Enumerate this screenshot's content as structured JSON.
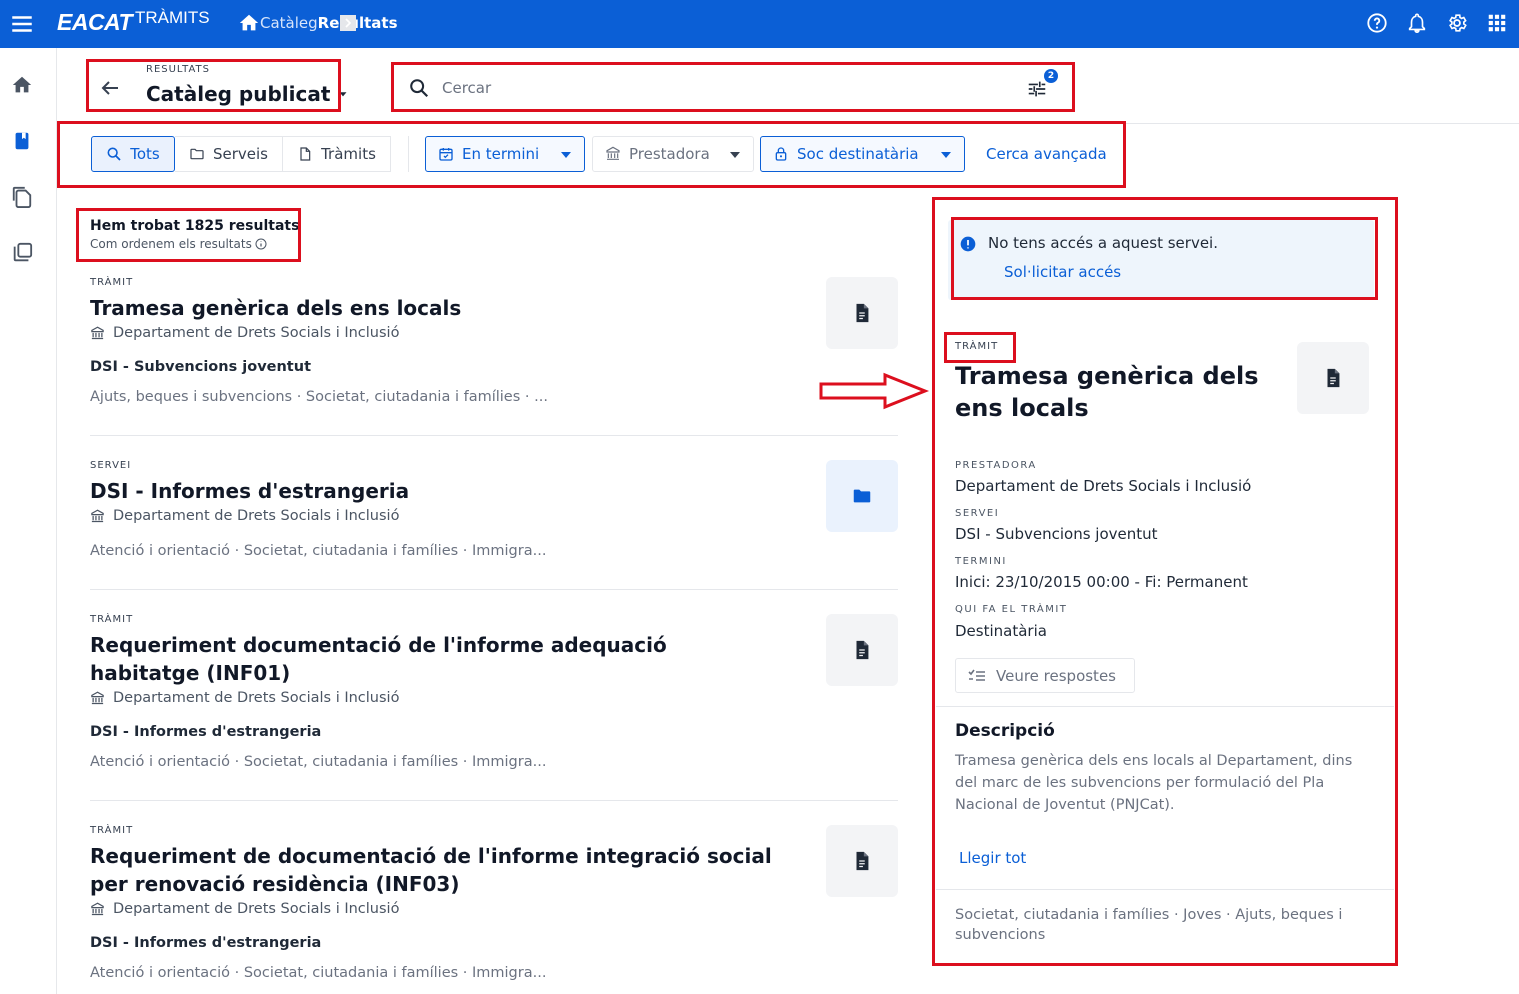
{
  "topbar": {
    "logo_main": "EACAT",
    "logo_sub": "TRÀMITS",
    "breadcrumb": [
      "Catàleg",
      "Resultats"
    ],
    "icons": [
      "help-icon",
      "bell-icon",
      "gear-icon",
      "apps-grid-icon"
    ]
  },
  "sidebar": {
    "items": [
      "home-icon",
      "catalog-book-icon",
      "documents-icon",
      "copies-icon"
    ]
  },
  "header": {
    "small_label": "RESULTATS",
    "title": "Catàleg publicat",
    "search_placeholder": "Cercar",
    "filter_count": "2"
  },
  "filters": {
    "segments": [
      "Tots",
      "Serveis",
      "Tràmits"
    ],
    "in_term": "En termini",
    "provider": "Prestadora",
    "recipient": "Soc destinatària",
    "advanced": "Cerca avançada"
  },
  "results": {
    "count": "Hem trobat 1825 resultats",
    "sort_note": "Com ordenem els resultats",
    "items": [
      {
        "kind": "TRÀMIT",
        "title": "Tramesa genèrica dels ens locals",
        "dept": "Departament de Drets Socials i Inclusió",
        "service": "DSI - Subvencions joventut",
        "tags": "Ajuts, beques i subvencions · Societat, ciutadania i famílies · ..."
      },
      {
        "kind": "SERVEI",
        "title": "DSI - Informes d'estrangeria",
        "dept": "Departament de Drets Socials i Inclusió",
        "service": "",
        "tags": "Atenció i orientació · Societat, ciutadania i famílies · Immigra..."
      },
      {
        "kind": "TRÀMIT",
        "title": "Requeriment documentació de l'informe adequació habitatge (INF01)",
        "dept": "Departament de Drets Socials i Inclusió",
        "service": "DSI - Informes d'estrangeria",
        "tags": "Atenció i orientació · Societat, ciutadania i famílies · Immigra..."
      },
      {
        "kind": "TRÀMIT",
        "title": "Requeriment de documentació de l'informe integració social per renovació residència (INF03)",
        "dept": "Departament de Drets Socials i Inclusió",
        "service": "DSI - Informes d'estrangeria",
        "tags": "Atenció i orientació · Societat, ciutadania i famílies · Immigra..."
      }
    ]
  },
  "detail": {
    "notice_text": "No tens accés a aquest servei.",
    "notice_link": "Sol·licitar accés",
    "kind": "TRÀMIT",
    "title": "Tramesa genèrica dels ens locals",
    "provider_label": "PRESTADORA",
    "provider": "Departament de Drets Socials i Inclusió",
    "service_label": "SERVEI",
    "service": "DSI - Subvencions joventut",
    "term_label": "TERMINI",
    "term": "Inici: 23/10/2015 00:00 - Fi: Permanent",
    "who_label": "QUI FA EL TRÀMIT",
    "who": "Destinatària",
    "answers_button": "Veure respostes",
    "desc_heading": "Descripció",
    "description": "Tramesa genèrica dels ens locals al Departament, dins del marc de les subvencions per formulació del Pla Nacional de Joventut (PNJCat).",
    "read_all": "Llegir tot",
    "tags": "Societat, ciutadania i famílies · Joves · Ajuts, beques i subvencions"
  },
  "colors": {
    "brand": "#0b5fd6",
    "annotation": "#dc0f1e"
  }
}
